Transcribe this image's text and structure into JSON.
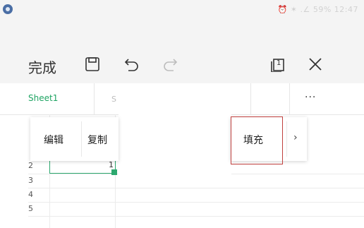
{
  "status": {
    "right_text": "⏰ ✶ .∠ 59%  12:47"
  },
  "toolbar": {
    "done_label": "完成",
    "icons": [
      "save-icon",
      "undo-icon",
      "redo-icon",
      "sheets-icon",
      "close-icon"
    ],
    "sheet_count": "1"
  },
  "tabs": {
    "sheet1": "Sheet1",
    "sheet2_partial": "S",
    "more": "···"
  },
  "grid": {
    "row_numbers": [
      "2",
      "3",
      "4",
      "5"
    ],
    "selected_cell_value": "1"
  },
  "context_menu": {
    "edit_label": "编辑",
    "copy_label": "复制",
    "fill_label": "填充",
    "next": "›"
  },
  "colors": {
    "accent": "#1fa463",
    "highlight": "#c0403e"
  }
}
